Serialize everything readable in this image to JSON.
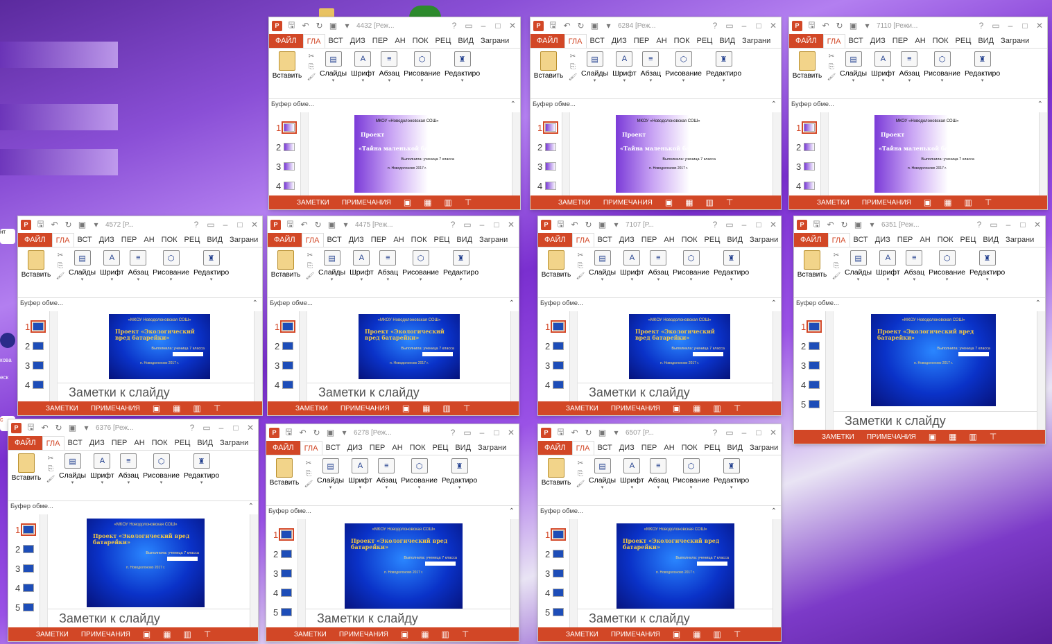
{
  "desktop": {
    "labels": [
      "нт",
      "кова",
      "еск",
      "с"
    ]
  },
  "ribbon": {
    "tabs": [
      "ФАЙЛ",
      "ГЛА",
      "ВСТ",
      "ДИЗ",
      "ПЕР",
      "АН",
      "ПОК",
      "РЕЦ",
      "ВИД",
      "Заграни"
    ],
    "paste": "Вставить",
    "groups": [
      "Слайды",
      "Шрифт",
      "Абзац",
      "Рисование",
      "Редактиро"
    ],
    "clipboard": "Буфер обме...",
    "caret": "▾"
  },
  "status": {
    "notes": "ЗАМЕТКИ",
    "comments": "ПРИМЕЧАНИЯ"
  },
  "notes_placeholder": "Заметки к слайду",
  "slides_purple": {
    "school": "МКОУ «Новодолоновская СОШ»",
    "title": "Проект",
    "subtitle": "«Тайна маленькой батарейки»",
    "author": "Выполнила: ученица 7 класса",
    "place": "п. Новодолоново 2017 г."
  },
  "slides_blue": {
    "school": "«МКОУ Новодолоновская СОШ»",
    "title": "Проект «Экологический вред батарейки»",
    "author": "Выполнила: ученица 7 класса",
    "place": "п. Новодолоново 2017 г."
  },
  "windows": [
    {
      "title": "4432 [Реж...",
      "theme": "purple"
    },
    {
      "title": "6284 [Реж...",
      "theme": "purple"
    },
    {
      "title": "7110 [Режи...",
      "theme": "purple"
    },
    {
      "title": "4572 [Р...",
      "theme": "blue"
    },
    {
      "title": "4475 [Реж...",
      "theme": "blue"
    },
    {
      "title": "7107 [Р...",
      "theme": "blue"
    },
    {
      "title": "6351 [Реж...",
      "theme": "blue"
    },
    {
      "title": "6376 [Реж...",
      "theme": "blue"
    },
    {
      "title": "6278 [Реж...",
      "theme": "blue"
    },
    {
      "title": "6507 [Р...",
      "theme": "blue"
    }
  ],
  "colors": {
    "accent": "#d24726",
    "slide_blue": "#0a32c8",
    "slide_purple": "#7b3bd8"
  }
}
